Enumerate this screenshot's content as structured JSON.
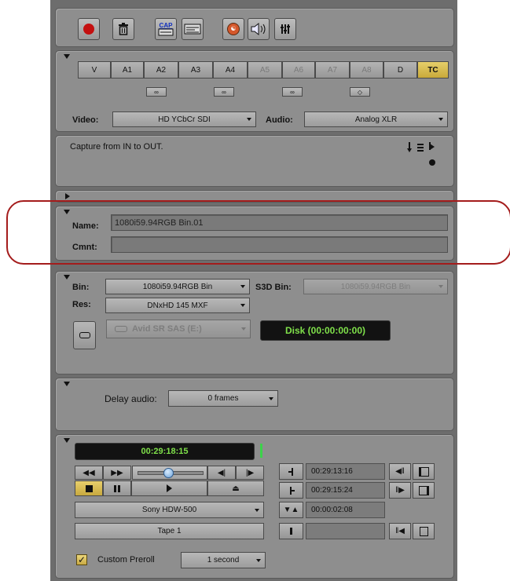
{
  "tracks": [
    "V",
    "A1",
    "A2",
    "A3",
    "A4",
    "A5",
    "A6",
    "A7",
    "A8",
    "D",
    "TC"
  ],
  "source": {
    "video_label": "Video:",
    "video_value": "HD YCbCr SDI",
    "audio_label": "Audio:",
    "audio_value": "Analog XLR"
  },
  "message": "Capture from IN to OUT.",
  "clip": {
    "name_label": "Name:",
    "name_value": "1080i59.94RGB Bin.01",
    "comment_label": "Cmnt:",
    "comment_value": ""
  },
  "target": {
    "bin_label": "Bin:",
    "bin_value": "1080i59.94RGB Bin",
    "s3d_label": "S3D Bin:",
    "s3d_value": "1080i59.94RGB Bin",
    "res_label": "Res:",
    "res_value": "DNxHD 145  MXF",
    "drive_value": "Avid SR SAS (E:)",
    "disk_status": "Disk (00:00:00:00)"
  },
  "delay": {
    "label": "Delay audio:",
    "value": "0 frames"
  },
  "deck": {
    "timecode": "00:29:18:15",
    "mark_in": "00:29:13:16",
    "mark_out": "00:29:15:24",
    "duration": "00:00:02:08",
    "deck_name": "Sony HDW-500",
    "tape_name": "Tape 1",
    "preroll_label": "Custom Preroll",
    "preroll_value": "1 second"
  },
  "colors": {
    "panel": "#8e8e8e",
    "frame": "#6d6d6d",
    "highlight_outline": "#a41c1c",
    "timecode_text": "#7fe04a",
    "tc_button": "#d8be50"
  }
}
